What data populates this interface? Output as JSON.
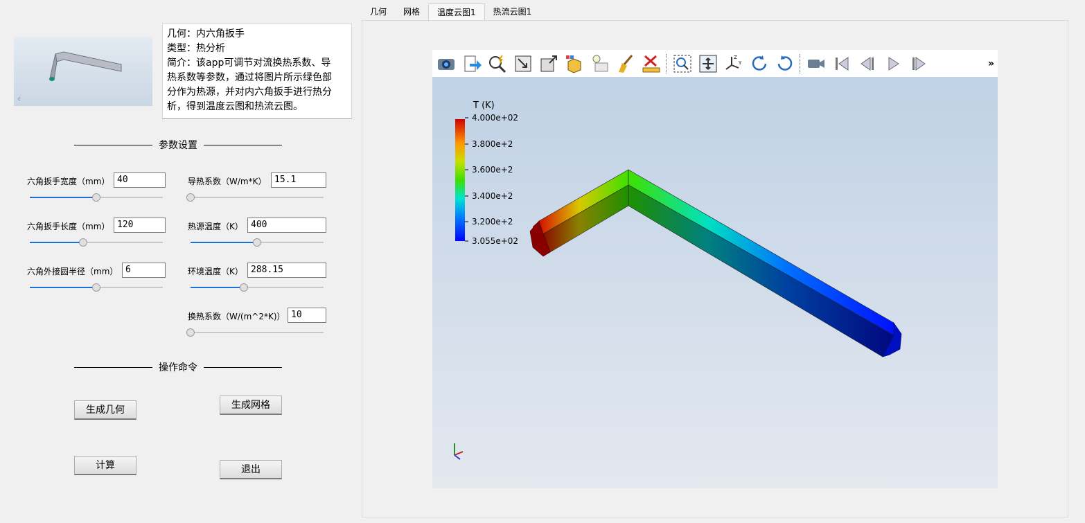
{
  "info": {
    "lines": [
      "几何：内六角扳手",
      "类型：热分析",
      "简介：该app可调节对流换热系数、导",
      "热系数等参数，通过将图片所示绿色部",
      "分作为热源，并对内六角扳手进行热分",
      "析，得到温度云图和热流云图。"
    ]
  },
  "params_section": "参数设置",
  "params": {
    "width": {
      "label": "六角扳手宽度（mm）",
      "value": "40",
      "slider": 0.5
    },
    "length": {
      "label": "六角扳手长度（mm）",
      "value": "120",
      "slider": 0.4
    },
    "radius": {
      "label": "六角外接圆半径（mm）",
      "value": "6",
      "slider": 0.5
    },
    "conductivity": {
      "label": "导热系数（W/m*K）",
      "value": "15.1",
      "slider": 0.0
    },
    "source_temp": {
      "label": "热源温度（K）",
      "value": "400",
      "slider": 0.5
    },
    "ambient_temp": {
      "label": "环境温度（K）",
      "value": "288.15",
      "slider": 0.4
    },
    "htc": {
      "label": "换热系数（W/(m^2*K)）",
      "value": "10",
      "slider": 0.0
    }
  },
  "ops_section": "操作命令",
  "buttons": {
    "gen_geometry": "生成几何",
    "gen_mesh": "生成网格",
    "compute": "计算",
    "exit": "退出"
  },
  "tabs": [
    "几何",
    "网格",
    "温度云图1",
    "热流云图1"
  ],
  "active_tab": "温度云图1",
  "toolbar": {
    "icons": [
      "camera-icon",
      "export-icon",
      "zoom-pick-icon",
      "fit-view-icon",
      "maximize-icon",
      "display-mode-icon",
      "light-icon",
      "clear-icon",
      "ruler-icon",
      "zoom-box-icon",
      "fit-all-icon",
      "axes-icon",
      "rotate-cw-icon",
      "rotate-ccw-icon",
      "video-icon",
      "first-frame-icon",
      "prev-frame-icon",
      "play-icon",
      "next-frame-icon"
    ],
    "more": "»"
  },
  "legend": {
    "title": "T (K)",
    "ticks": [
      "4.000e+02",
      "3.800e+2",
      "3.600e+2",
      "3.400e+2",
      "3.200e+2",
      "3.055e+02"
    ],
    "colors": [
      "#d40000",
      "#ffd400",
      "#3ee000",
      "#00e5d0",
      "#0060ff",
      "#0000ff"
    ]
  }
}
